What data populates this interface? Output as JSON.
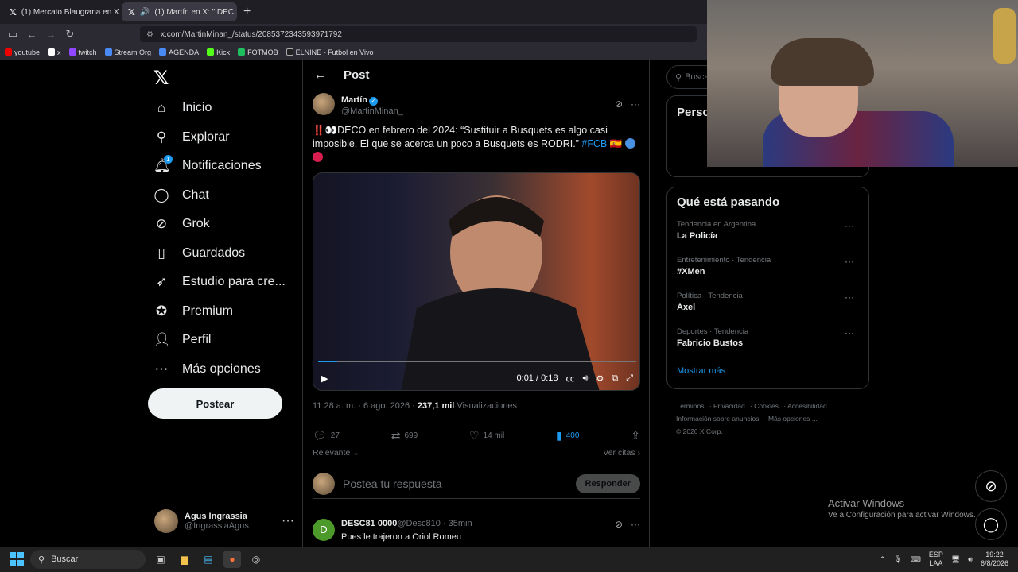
{
  "browser": {
    "tabs": [
      {
        "label": "(1) Mercato Blaugrana en X: \"",
        "active": false
      },
      {
        "label": "(1) Martín en X: \" DEC",
        "active": true
      }
    ],
    "url": "x.com/MartinMinan_/status/2085372343593971792",
    "bookmarks": [
      "youtube",
      "x",
      "twitch",
      "Stream Org",
      "AGENDA",
      "Kick",
      "FOTMOB",
      "ELNINE - Futbol en Vivo"
    ]
  },
  "sidebar": {
    "items": [
      {
        "label": "Inicio",
        "icon": "home-icon"
      },
      {
        "label": "Explorar",
        "icon": "search-icon"
      },
      {
        "label": "Notificaciones",
        "icon": "bell-icon",
        "badge": "1"
      },
      {
        "label": "Chat",
        "icon": "chat-icon"
      },
      {
        "label": "Grok",
        "icon": "grok-icon"
      },
      {
        "label": "Guardados",
        "icon": "bookmark-icon"
      },
      {
        "label": "Estudio para cre...",
        "icon": "rocket-icon"
      },
      {
        "label": "Premium",
        "icon": "premium-icon"
      },
      {
        "label": "Perfil",
        "icon": "profile-icon"
      },
      {
        "label": "Más opciones",
        "icon": "more-icon"
      }
    ],
    "post_button": "Postear",
    "user": {
      "name": "Agus Ingrassia",
      "handle": "@IngrassiaAgus"
    }
  },
  "post": {
    "header": "Post",
    "author": {
      "name": "Martín",
      "handle": "@MartinMinan_"
    },
    "text_prefix": "‼️👀DECO en febrero del 2024: “Sustituir a Busquets es algo casi imposible. El que se acerca un poco a Busquets es RODRI.”",
    "hashtag": "#FCB",
    "video": {
      "time": "0:01 / 0:18",
      "progress": 0.06
    },
    "timestamp": "11:28 a. m. · 6 ago. 2026 · ",
    "views_count": "237,1 mil",
    "views_label": " Visualizaciones",
    "stats": {
      "replies": "27",
      "reposts": "699",
      "likes": "14 mil",
      "saves": "400"
    },
    "sort_label": "Relevante",
    "quotes_label": "Ver citas",
    "reply_placeholder": "Postea tu respuesta",
    "reply_button": "Responder"
  },
  "comment": {
    "initial": "D",
    "name": "DESC81 0000",
    "meta": " @Desc810 · 35min",
    "text": "Pues le trajeron a Oriol Romeu"
  },
  "right": {
    "search_placeholder": "Busca",
    "box_title": "Perso",
    "trends_title": "Qué está pasando",
    "trends": [
      {
        "context": "Tendencia en Argentina",
        "name": "La Policía"
      },
      {
        "context": "Entretenimiento · Tendencia",
        "name": "#XMen"
      },
      {
        "context": "Política · Tendencia",
        "name": "Axel"
      },
      {
        "context": "Deportes · Tendencia",
        "name": "Fabricio Bustos"
      }
    ],
    "show_more": "Mostrar más",
    "footer": [
      "Términos",
      "Privacidad",
      "Cookies",
      "Accesibilidad",
      "Información sobre anuncios",
      "Más opciones ...",
      "© 2026 X Corp."
    ]
  },
  "windows": {
    "activate_title": "Activar Windows",
    "activate_sub": "Ve a Configuración para activar Windows.",
    "search": "Buscar",
    "lang": "ESP",
    "lang2": "LAA",
    "time": "19:22",
    "date": "6/8/2026"
  },
  "colors": {
    "accent": "#1d9bf0",
    "bg": "#000000",
    "button": "#eff3f4"
  }
}
